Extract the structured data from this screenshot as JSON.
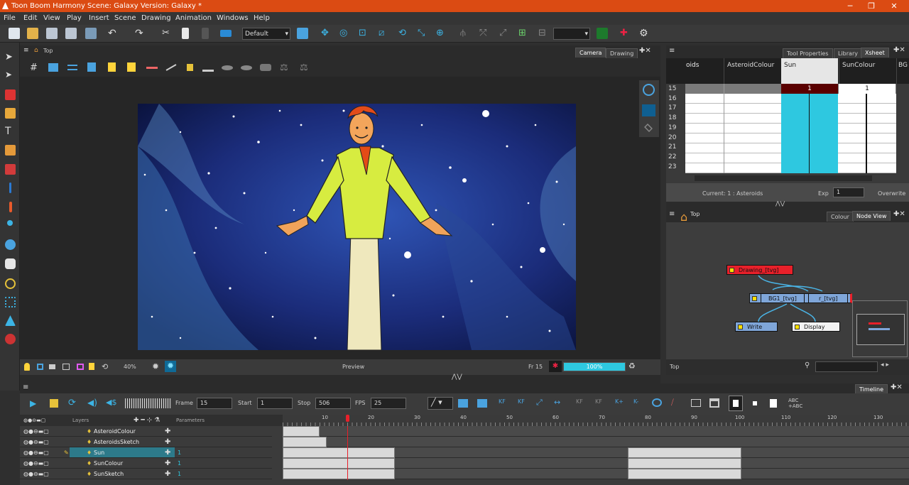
{
  "titlebar": {
    "title": "Toon Boom Harmony Scene: Galaxy Version: Galaxy *",
    "minimize": "─",
    "maximize": "❐",
    "close": "✕"
  },
  "menu": [
    "File",
    "Edit",
    "View",
    "Play",
    "Insert",
    "Scene",
    "Drawing",
    "Animation",
    "Windows",
    "Help"
  ],
  "toolbar": {
    "preset": "Default"
  },
  "camera_view": {
    "breadcrumb": "Top",
    "tabs": [
      "Camera",
      "Drawing"
    ],
    "zoom": "40%",
    "preview_label": "Preview",
    "frame_label": "Fr 15",
    "progress_label": "100%",
    "progress_value": 1.0
  },
  "xsheet": {
    "tabs": [
      "Tool Properties",
      "Library",
      "Xsheet"
    ],
    "columns": [
      "oids",
      "AsteroidColour",
      "Sun",
      "SunColour",
      "BG"
    ],
    "rows": [
      "15",
      "16",
      "17",
      "18",
      "19",
      "20",
      "21",
      "22",
      "23"
    ],
    "sun_value": "1",
    "suncolour_value": "1",
    "current": "Current: 1 : Asteroids",
    "exp_label": "Exp",
    "exp_value": "1",
    "overwrite": "Overwrite"
  },
  "nodeview": {
    "breadcrumb": "Top",
    "tabs": [
      "Colour",
      "Node View"
    ],
    "nodes": {
      "drawing": "Drawing_[tvg]",
      "bg": "BG1_[tvg]",
      "bg_partial": "r_[tvg]",
      "write": "Write",
      "display": "Display"
    },
    "footer": "Top"
  },
  "timeline": {
    "tab": "Timeline",
    "frame_label": "Frame",
    "frame_value": "15",
    "start_label": "Start",
    "start_value": "1",
    "stop_label": "Stop",
    "stop_value": "506",
    "fps_label": "FPS",
    "fps_value": "25",
    "layers_header": "Layers",
    "params_header": "Parameters",
    "ruler": [
      "10",
      "20",
      "30",
      "40",
      "50",
      "60",
      "70",
      "80",
      "90",
      "100",
      "110",
      "120",
      "130"
    ],
    "layers": [
      {
        "name": "AsteroidColour",
        "param": ""
      },
      {
        "name": "AsteroidsSketch",
        "param": ""
      },
      {
        "name": "Sun",
        "param": "1"
      },
      {
        "name": "SunColour",
        "param": "1"
      },
      {
        "name": "SunSketch",
        "param": "1"
      }
    ]
  },
  "colors": {
    "accent": "#db4b13",
    "selection": "#2ec8e0",
    "node_red": "#e8202a",
    "node_blue": "#7fa6d9"
  }
}
